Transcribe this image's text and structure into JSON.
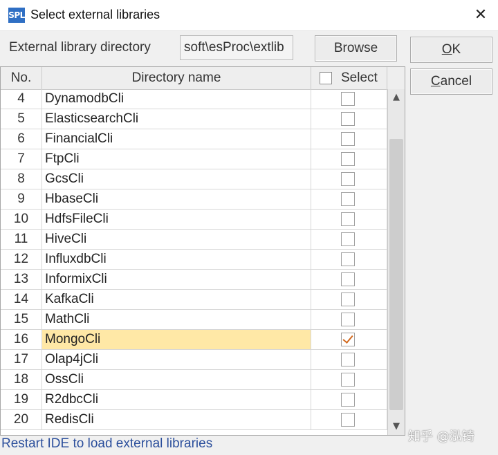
{
  "window": {
    "icon_text": "SPL",
    "title": "Select external libraries",
    "close_glyph": "✕"
  },
  "directory": {
    "label": "External library directory",
    "value": "soft\\esProc\\extlib"
  },
  "buttons": {
    "browse": "Browse",
    "ok": "OK",
    "cancel": "Cancel"
  },
  "table": {
    "headers": {
      "no": "No.",
      "name": "Directory name",
      "select": "Select"
    },
    "rows": [
      {
        "no": "4",
        "name": "DynamodbCli",
        "checked": false
      },
      {
        "no": "5",
        "name": "ElasticsearchCli",
        "checked": false
      },
      {
        "no": "6",
        "name": "FinancialCli",
        "checked": false
      },
      {
        "no": "7",
        "name": "FtpCli",
        "checked": false
      },
      {
        "no": "8",
        "name": "GcsCli",
        "checked": false
      },
      {
        "no": "9",
        "name": "HbaseCli",
        "checked": false
      },
      {
        "no": "10",
        "name": "HdfsFileCli",
        "checked": false
      },
      {
        "no": "11",
        "name": "HiveCli",
        "checked": false
      },
      {
        "no": "12",
        "name": "InfluxdbCli",
        "checked": false
      },
      {
        "no": "13",
        "name": "InformixCli",
        "checked": false
      },
      {
        "no": "14",
        "name": "KafkaCli",
        "checked": false
      },
      {
        "no": "15",
        "name": "MathCli",
        "checked": false
      },
      {
        "no": "16",
        "name": "MongoCli",
        "checked": true,
        "selected": true
      },
      {
        "no": "17",
        "name": "Olap4jCli",
        "checked": false
      },
      {
        "no": "18",
        "name": "OssCli",
        "checked": false
      },
      {
        "no": "19",
        "name": "R2dbcCli",
        "checked": false
      },
      {
        "no": "20",
        "name": "RedisCli",
        "checked": false
      }
    ]
  },
  "scrollbar": {
    "up_glyph": "▲",
    "down_glyph": "▼"
  },
  "status": "Restart IDE to load external libraries",
  "watermark": "知乎 @泓锜",
  "colors": {
    "selected_row": "#ffe8a6",
    "checkmark": "#d2691e",
    "status_text": "#2c4f9c",
    "app_icon": "#2f6fc4"
  }
}
